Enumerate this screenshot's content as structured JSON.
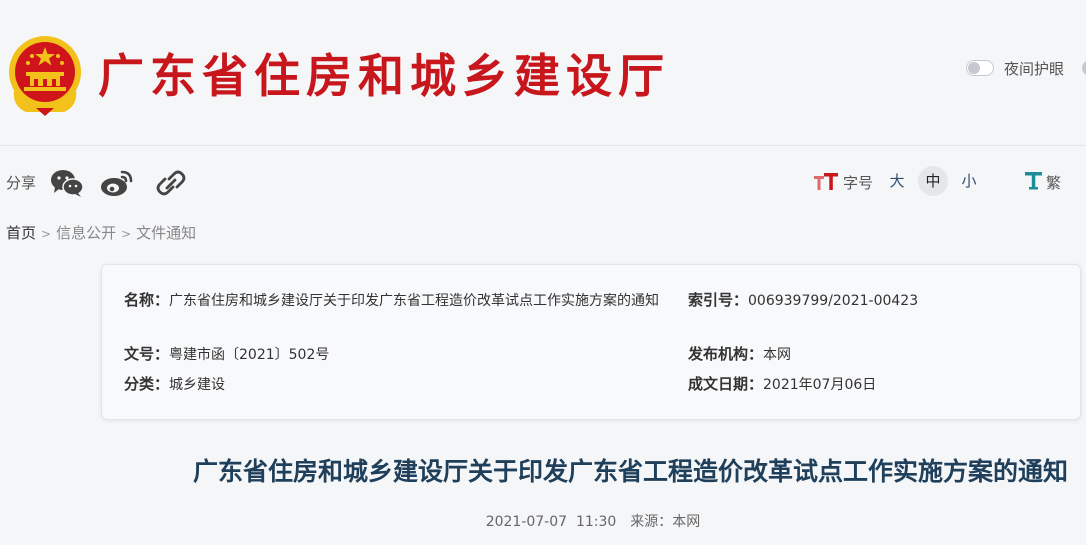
{
  "header": {
    "site_title": "广东省住房和城乡建设厅",
    "night_mode_label": "夜间护眼"
  },
  "toolbar": {
    "share_label": "分享",
    "font_size_label": "字号",
    "font_large": "大",
    "font_medium": "中",
    "font_small": "小",
    "traditional_label": "繁"
  },
  "breadcrumb": {
    "home": "首页",
    "level1": "信息公开",
    "level2": "文件通知",
    "separator": ">"
  },
  "info": {
    "name_key": "名称：",
    "name_value": "广东省住房和城乡建设厅关于印发广东省工程造价改革试点工作实施方案的通知",
    "index_key": "索引号：",
    "index_value": "006939799/2021-00423",
    "docno_key": "文号：",
    "docno_value": "粤建市函〔2021〕502号",
    "org_key": "发布机构：",
    "org_value": "本网",
    "category_key": "分类：",
    "category_value": "城乡建设",
    "date_key": "成文日期：",
    "date_value": "2021年07月06日"
  },
  "article": {
    "title": "广东省住房和城乡建设厅关于印发广东省工程造价改革试点工作实施方案的通知",
    "datetime": "2021-07-07  11:30",
    "source": "来源：本网"
  },
  "colors": {
    "brand_red": "#c8161d",
    "title_blue": "#1f3f5a",
    "gold": "#f2c21a"
  }
}
